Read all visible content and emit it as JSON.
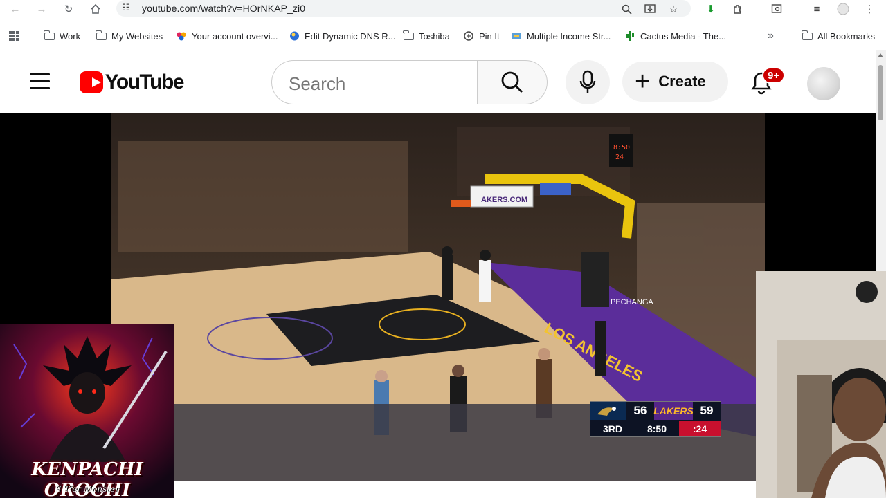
{
  "browser": {
    "url": "youtube.com/watch?v=HOrNKAP_zi0",
    "bookmarks": [
      {
        "label": "Work",
        "icon": "folder-icon"
      },
      {
        "label": "My Websites",
        "icon": "folder-icon"
      },
      {
        "label": "Your account overvi...",
        "icon": "account-icon"
      },
      {
        "label": "Edit Dynamic DNS R...",
        "icon": "dns-icon"
      },
      {
        "label": "Toshiba",
        "icon": "folder-icon"
      },
      {
        "label": "Pin It",
        "icon": "pin-icon"
      },
      {
        "label": "Multiple Income Str...",
        "icon": "income-icon"
      },
      {
        "label": "Cactus Media - The...",
        "icon": "cactus-icon"
      }
    ],
    "all_bookmarks": "All Bookmarks"
  },
  "youtube": {
    "logo_text": "YouTube",
    "search_placeholder": "Search",
    "create_label": "Create",
    "notification_badge": "9+"
  },
  "scoreboard": {
    "home_score": "56",
    "away_team": "LAKERS",
    "away_score": "59",
    "period": "3RD",
    "clock": "8:50",
    "shot_clock": ":24"
  },
  "thumbnail": {
    "title": "KENPACHI OROCHI",
    "subtitle": "S-Tier Monster"
  },
  "colors": {
    "youtube_red": "#ff0000",
    "badge_red": "#cc0000",
    "lakers_purple": "#55258a",
    "lakers_gold": "#fdb927",
    "pelicans_navy": "#0b2a52"
  }
}
